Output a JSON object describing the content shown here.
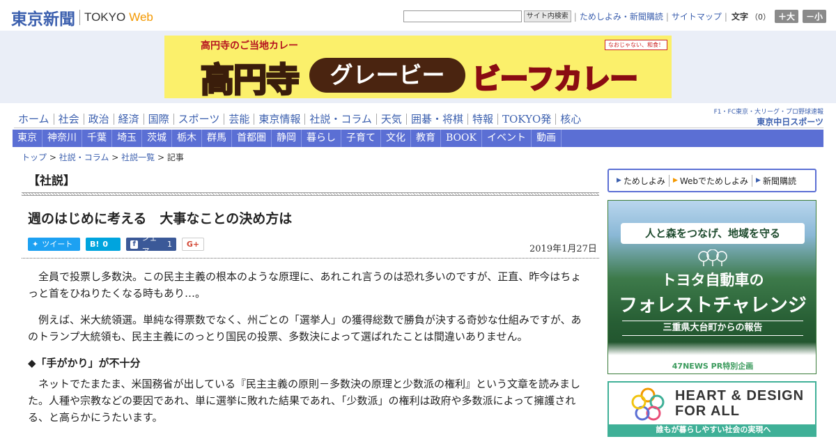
{
  "header": {
    "logo_jp": "東京新聞",
    "logo_en": "TOKYO",
    "logo_web": "Web",
    "search": {
      "placeholder": "",
      "button_label": "サイト内検索"
    },
    "links": [
      "ためしよみ・新聞購読",
      "サイトマップ"
    ],
    "font_size": {
      "label": "文字",
      "count": "（0）",
      "increase": "＋大",
      "decrease": "－小"
    }
  },
  "banner_ad": {
    "top_text": "高円寺のご当地カレー",
    "main_text": "高円寺",
    "gravy_text": "グレービー",
    "beef_text": "ビーフカレー",
    "badge_text": "なおじゃない、和食！"
  },
  "nav_primary": {
    "items": [
      "ホーム",
      "社会",
      "政治",
      "経済",
      "国際",
      "スポーツ",
      "芸能",
      "東京情報",
      "社説・コラム",
      "天気",
      "囲碁・将棋",
      "特報",
      "TOKYO発",
      "核心"
    ],
    "partner_small": "F1・FC東京・大リーグ・プロ野球速報",
    "partner_logo": "東京中日スポーツ"
  },
  "nav_secondary": {
    "items": [
      "東京",
      "神奈川",
      "千葉",
      "埼玉",
      "茨城",
      "栃木",
      "群馬",
      "首都圏",
      "静岡",
      "暮らし",
      "子育て",
      "文化",
      "教育",
      "BOOK",
      "イベント",
      "動画"
    ]
  },
  "breadcrumb": {
    "items": [
      "トップ",
      "社説・コラム",
      "社説一覧"
    ],
    "current": "記事",
    "separator": ">"
  },
  "article": {
    "section_label": "【社説】",
    "title": "週のはじめに考える　大事なことの決め方は",
    "share": {
      "tweet_label": "ツイート",
      "hatena_label": "B!",
      "hatena_count": "0",
      "facebook_label": "シェア",
      "facebook_count": "1",
      "gplus_label": "G+"
    },
    "date": "2019年1月27日",
    "paragraphs": [
      "全員で投票し多数決。この民主主義の根本のような原理に、あれこれ言うのは恐れ多いのですが、正直、昨今はちょっと首をひねりたくなる時もあり…。",
      "例えば、米大統領選。単純な得票数でなく、州ごとの「選挙人」の獲得総数で勝負が決する奇妙な仕組みですが、あのトランプ大統領も、民主主義にのっとり国民の投票、多数決によって選ばれたことは間違いありません。"
    ],
    "subhead": "◆「手がかり」が不十分",
    "paragraph3": "ネットでたまたま、米国務省が出している『民主主義の原則－多数決の原理と少数派の権利』という文章を読みました。人種や宗教などの要因であれ、単に選挙に敗れた結果であれ、「少数派」の権利は政府や多数派によって擁護される、と高らかにうたいます。"
  },
  "sidebar": {
    "subscribe": [
      "ためしよみ",
      "Webでためしよみ",
      "新聞購読"
    ],
    "ad_forest": {
      "ribbon": "人と森をつなげ、地域を守る",
      "company": "トヨタ自動車の",
      "challenge": "フォレストチャレンジ",
      "subtitle": "三重県大台町からの報告",
      "footer": "47NEWS PR特別企画"
    },
    "ad_heart": {
      "title_line1": "HEART & DESIGN",
      "title_line2": "FOR ALL",
      "bar": "誰もが暮らしやすい社会の実現へ"
    }
  },
  "colors": {
    "brand_blue": "#3b5fae",
    "nav_blue": "#5b6fd4",
    "accent_orange": "#f39800",
    "ad_band": "#eaeef7"
  }
}
